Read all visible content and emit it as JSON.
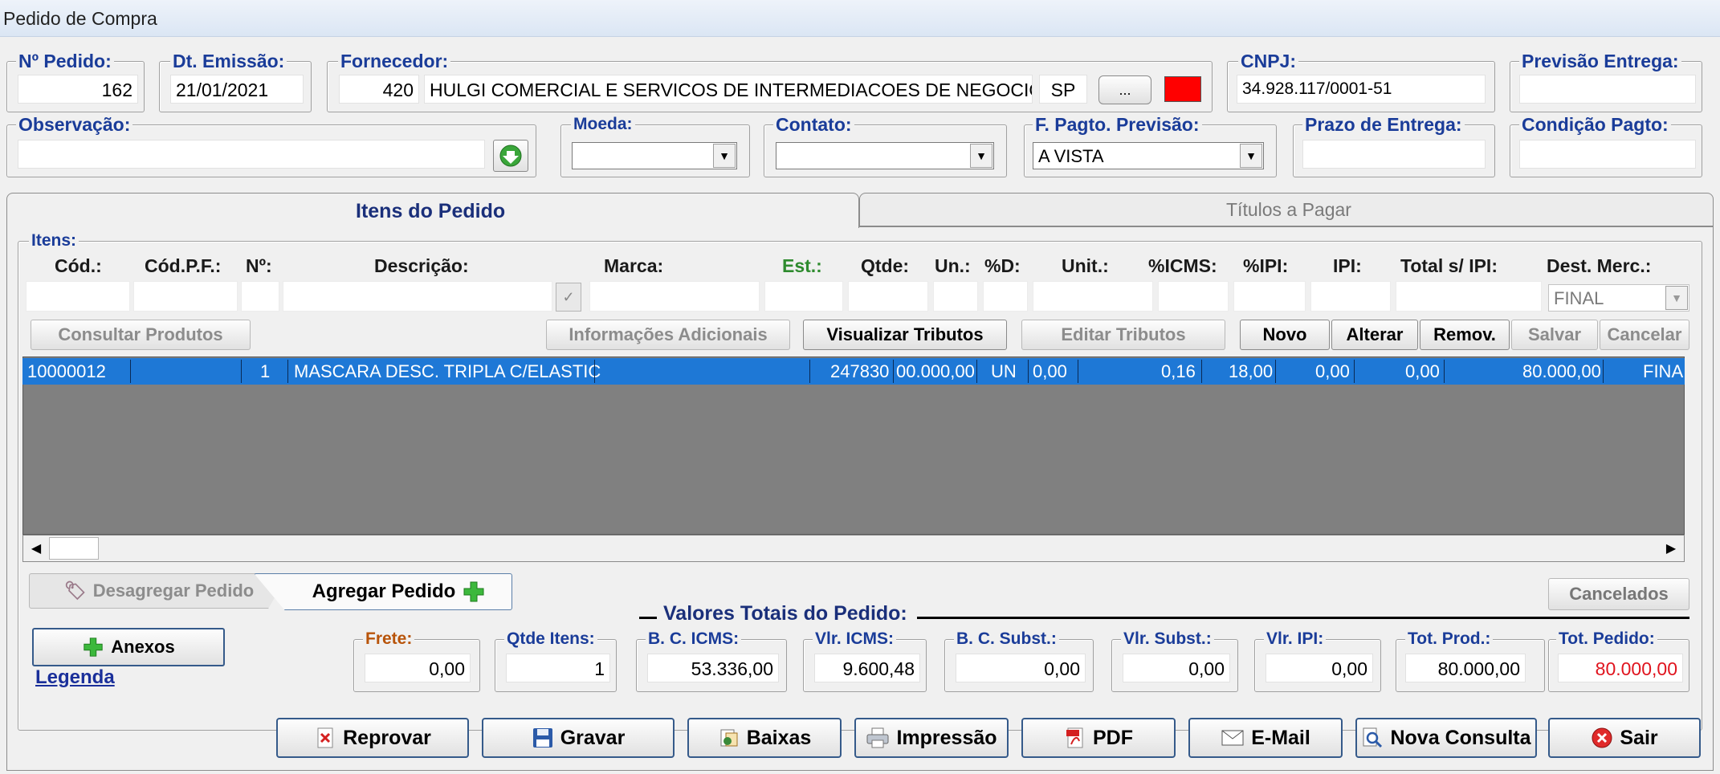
{
  "window": {
    "title": "Pedido de Compra"
  },
  "header": {
    "pedido": {
      "label": "Nº Pedido:",
      "value": "162"
    },
    "emissao": {
      "label": "Dt. Emissão:",
      "value": "21/01/2021"
    },
    "fornecedor": {
      "label": "Fornecedor:",
      "code": "420",
      "name": "HULGI COMERCIAL E SERVICOS DE INTERMEDIACOES DE NEGOCIOS",
      "uf": "SP",
      "button": "..."
    },
    "cnpj": {
      "label": "CNPJ:",
      "value": "34.928.117/0001-51"
    },
    "previsao_entrega": {
      "label": "Previsão Entrega:",
      "value": ""
    },
    "observacao": {
      "label": "Observação:",
      "value": ""
    },
    "moeda": {
      "label": "Moeda:",
      "value": ""
    },
    "contato": {
      "label": "Contato:",
      "value": ""
    },
    "fpagto": {
      "label": "F. Pagto. Previsão:",
      "value": "A VISTA"
    },
    "prazo": {
      "label": "Prazo de Entrega:",
      "value": ""
    },
    "condicao": {
      "label": "Condição Pagto:",
      "value": ""
    }
  },
  "tabs": [
    {
      "label": "Itens do Pedido"
    },
    {
      "label": "Títulos a Pagar"
    }
  ],
  "itens": {
    "group_label": "Itens:",
    "columns": [
      "Cód.:",
      "Cód.P.F.:",
      "Nº:",
      "Descrição:",
      "Marca:",
      "Est.:",
      "Qtde:",
      "Un.:",
      "%D:",
      "Unit.:",
      "%ICMS:",
      "%IPI:",
      "IPI:",
      "Total s/ IPI:",
      "Dest. Merc.:"
    ],
    "dest_value": "FINAL",
    "buttons": {
      "consultar": "Consultar Produtos",
      "info": "Informações Adicionais",
      "visualizar": "Visualizar Tributos",
      "editar": "Editar Tributos",
      "novo": "Novo",
      "alterar": "Alterar",
      "remover": "Remov.",
      "salvar": "Salvar",
      "cancelar": "Cancelar"
    },
    "row": {
      "cod": "10000012",
      "codpf": "",
      "num": "1",
      "descricao": "MASCARA DESC. TRIPLA C/ELASTIC",
      "marca": "",
      "est": "247830",
      "qtde": "00.000,00",
      "un": "UN",
      "d": "0,00",
      "unit": "0,16",
      "icms": "18,00",
      "ipi_pct": "0,00",
      "ipi": "0,00",
      "total": "80.000,00",
      "dest": "FINA"
    }
  },
  "actions": {
    "desagregar": "Desagregar Pedido",
    "agregar": "Agregar Pedido",
    "cancelados": "Cancelados",
    "anexos": "Anexos",
    "legenda": "Legenda"
  },
  "totais": {
    "title": "Valores Totais do Pedido:",
    "frete": {
      "label": "Frete:",
      "value": "0,00"
    },
    "qtde_itens": {
      "label": "Qtde Itens:",
      "value": "1"
    },
    "bc_icms": {
      "label": "B. C. ICMS:",
      "value": "53.336,00"
    },
    "vlr_icms": {
      "label": "Vlr. ICMS:",
      "value": "9.600,48"
    },
    "bc_subst": {
      "label": "B. C. Subst.:",
      "value": "0,00"
    },
    "vlr_subst": {
      "label": "Vlr. Subst.:",
      "value": "0,00"
    },
    "vlr_ipi": {
      "label": "Vlr. IPI:",
      "value": "0,00"
    },
    "tot_prod": {
      "label": "Tot. Prod.:",
      "value": "80.000,00"
    },
    "tot_pedido": {
      "label": "Tot. Pedido:",
      "value": "80.000,00"
    }
  },
  "footer": {
    "reprovar": "Reprovar",
    "gravar": "Gravar",
    "baixas": "Baixas",
    "impressao": "Impressão",
    "pdf": "PDF",
    "email": "E-Mail",
    "nova_consulta": "Nova Consulta",
    "sair": "Sair"
  },
  "colors": {
    "label_blue": "#1a3c99",
    "selection": "#1e78d6",
    "grid_bg": "#808080",
    "red_value": "#e0141e",
    "est_green": "#2e8b2e"
  }
}
